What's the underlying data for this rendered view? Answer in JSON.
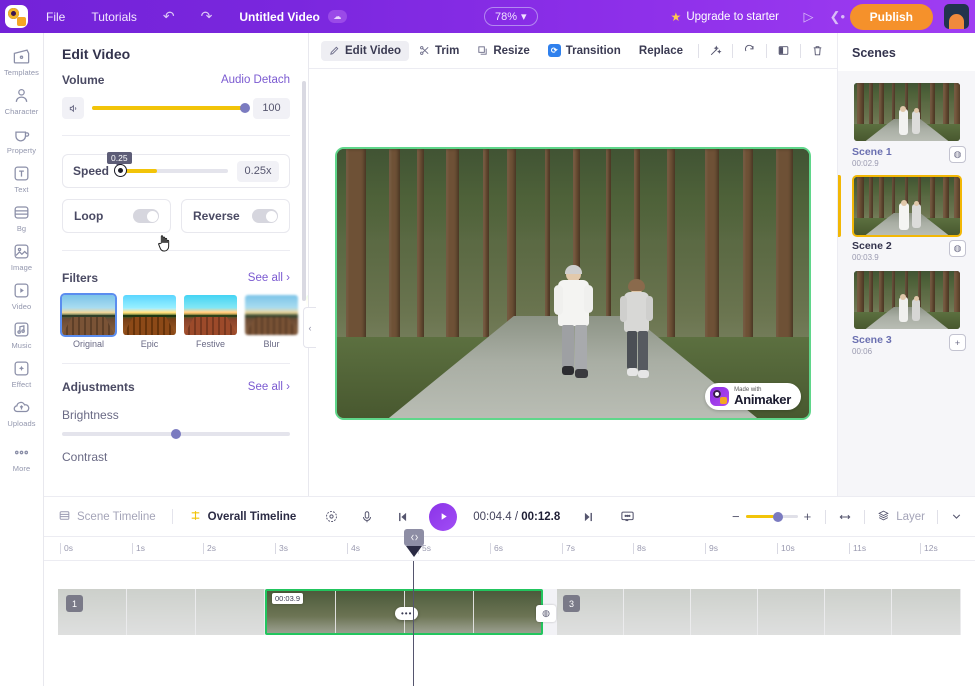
{
  "topbar": {
    "menu": [
      {
        "label": "File",
        "name": "menu-file"
      },
      {
        "label": "Tutorials",
        "name": "menu-tutorials"
      }
    ],
    "undo_icon": "undo-icon",
    "redo_icon": "redo-icon",
    "project_title": "Untitled Video",
    "cloud_icon": "cloud-saved-icon",
    "zoom_level": "78%",
    "zoom_caret": "▾",
    "upgrade_label": "Upgrade to starter",
    "upgrade_star": "★",
    "present_icon": "play-present-icon",
    "share_icon": "share-icon",
    "publish_label": "Publish",
    "avatar": "user-avatar"
  },
  "rail": [
    {
      "label": "Templates",
      "icon": "templates-icon"
    },
    {
      "label": "Character",
      "icon": "character-icon"
    },
    {
      "label": "Property",
      "icon": "property-icon"
    },
    {
      "label": "Text",
      "icon": "text-icon"
    },
    {
      "label": "Bg",
      "icon": "background-icon"
    },
    {
      "label": "Image",
      "icon": "image-icon"
    },
    {
      "label": "Video",
      "icon": "video-icon"
    },
    {
      "label": "Music",
      "icon": "music-icon"
    },
    {
      "label": "Effect",
      "icon": "effect-icon"
    },
    {
      "label": "Uploads",
      "icon": "uploads-icon"
    },
    {
      "label": "More",
      "icon": "more-icon"
    }
  ],
  "panel": {
    "title": "Edit Video",
    "volume_label": "Volume",
    "audio_detach_label": "Audio Detach",
    "volume_value": "100",
    "volume_percent": 100,
    "speed_label": "Speed",
    "speed_value": "0.25x",
    "speed_tooltip": "0.25",
    "speed_percent": 11,
    "loop_label": "Loop",
    "reverse_label": "Reverse",
    "filters_label": "Filters",
    "see_all_label": "See all",
    "chevron": "›",
    "filters": [
      {
        "label": "Original"
      },
      {
        "label": "Epic"
      },
      {
        "label": "Festive"
      },
      {
        "label": "Blur"
      }
    ],
    "adjustments_label": "Adjustments",
    "brightness_label": "Brightness",
    "brightness_percent": 50,
    "contrast_label": "Contrast",
    "collapse_chevron": "‹"
  },
  "canvas_toolbar": {
    "edit_video": "Edit Video",
    "trim": "Trim",
    "resize": "Resize",
    "transition": "Transition",
    "replace": "Replace",
    "magic_icon": "magic-wand-icon",
    "rotate_icon": "rotate-icon",
    "flip_icon": "flip-icon",
    "delete_icon": "trash-icon"
  },
  "watermark": {
    "small": "Made with",
    "large": "Animaker"
  },
  "scenes": {
    "title": "Scenes",
    "items": [
      {
        "name": "Scene 1",
        "duration": "00:02.9",
        "action": "duplicate-icon",
        "selected": false
      },
      {
        "name": "Scene 2",
        "duration": "00:03.9",
        "action": "duplicate-icon",
        "selected": true
      },
      {
        "name": "Scene 3",
        "duration": "00:06",
        "action": "add-icon",
        "selected": false
      }
    ]
  },
  "timeline": {
    "scene_tab": "Scene Timeline",
    "overall_tab": "Overall Timeline",
    "focus_icon": "focus-icon",
    "mic_icon": "microphone-icon",
    "prev_icon": "skip-previous-icon",
    "play_icon": "play-icon",
    "current_time": "00:04.4",
    "separator": "/",
    "total_time": "00:12.8",
    "next_icon": "skip-next-icon",
    "caption_icon": "caption-icon",
    "zoom_minus": "−",
    "zoom_plus": "+",
    "fit_icon": "fit-width-icon",
    "layer_label": "Layer",
    "layer_icon": "layers-icon",
    "expand_icon": "chevron-down-icon",
    "ruler_ticks": [
      "0s",
      "1s",
      "2s",
      "3s",
      "4s",
      "5s",
      "6s",
      "7s",
      "8s",
      "9s",
      "10s",
      "11s",
      "12s"
    ],
    "clip_start_label": "00:03.9",
    "track_badge_left": "1",
    "track_badge_right": "3",
    "clip_menu_dots": "•••",
    "join_icon": "join-clips-icon",
    "playhead_icon": "playhead-handle"
  },
  "colors": {
    "brand_purple": "#7a27de",
    "accent_orange": "#f5912b",
    "slider_yellow": "#f2c409",
    "selection_green": "#22c55e",
    "scene_selected": "#f2b705",
    "link_purple": "#7b5ad1"
  }
}
